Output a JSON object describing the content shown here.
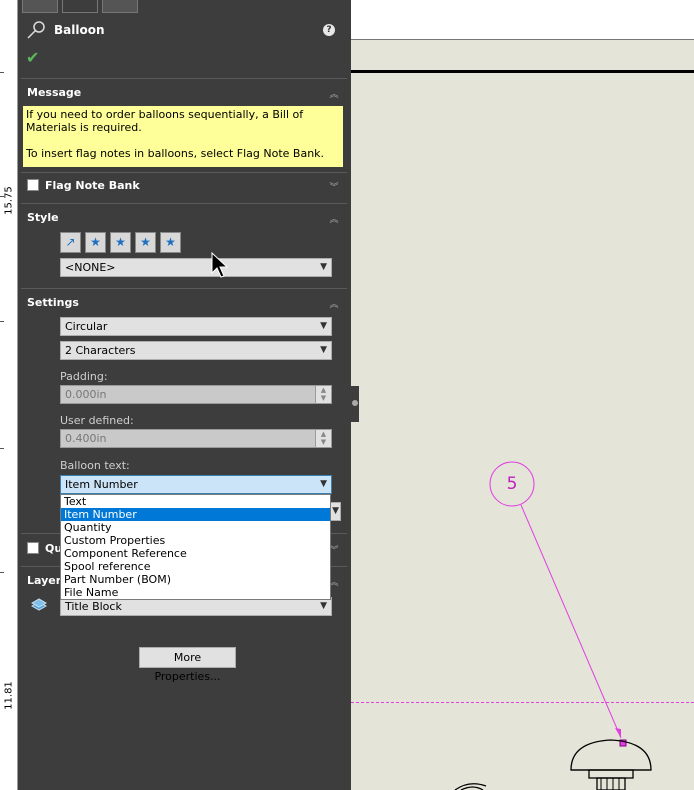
{
  "ruler": {
    "labels": [
      "15.75",
      "11.81"
    ]
  },
  "panel": {
    "title": "Balloon",
    "help": "?",
    "message": {
      "header": "Message",
      "line1": "If you need to order balloons sequentially, a Bill of Materials is required.",
      "line2": "To insert flag notes in balloons, select Flag Note Bank."
    },
    "flag_note_bank": {
      "label": "Flag Note Bank",
      "checked": false
    },
    "style": {
      "header": "Style",
      "selected": "<NONE>"
    },
    "settings": {
      "header": "Settings",
      "shape": "Circular",
      "size": "2 Characters",
      "padding_label": "Padding:",
      "padding_value": "0.000in",
      "user_defined_label": "User defined:",
      "user_defined_value": "0.400in",
      "balloon_text_label": "Balloon text:",
      "balloon_text_value": "Item Number",
      "balloon_text_options": [
        "Text",
        "Item Number",
        "Quantity",
        "Custom Properties",
        "Component Reference",
        "Spool reference",
        "Part Number (BOM)",
        "File Name"
      ]
    },
    "quantity_checkbox": {
      "label": "Qu"
    },
    "layer": {
      "header": "Layer",
      "value": "Title Block"
    },
    "more_properties": "More Properties..."
  },
  "drawing": {
    "balloon_number": "5",
    "accent": "#e040e0"
  }
}
